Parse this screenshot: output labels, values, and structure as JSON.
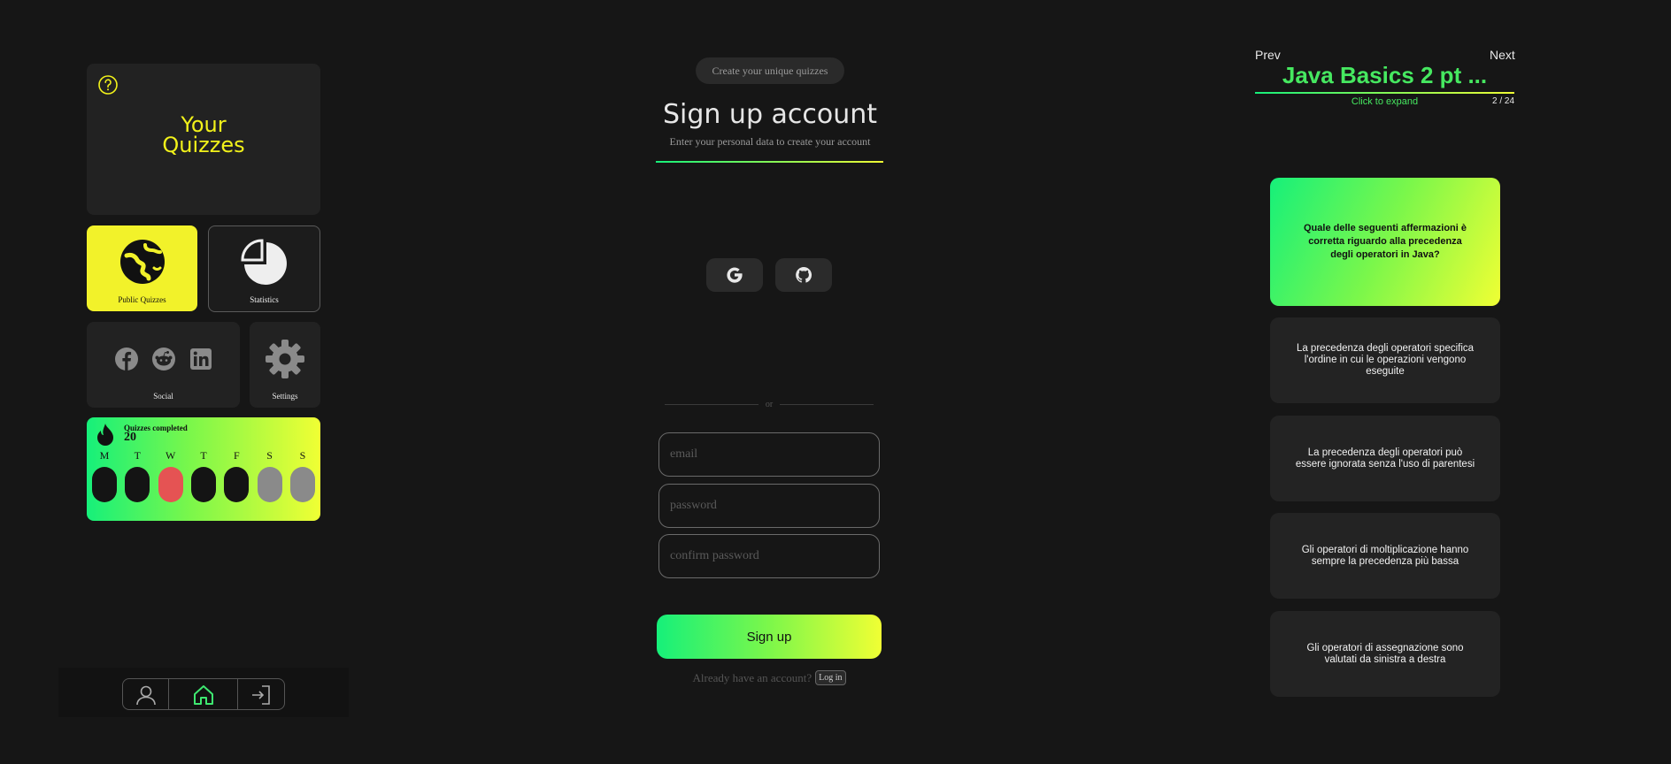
{
  "dashboard": {
    "your_quizzes": "Your\nQuizzes",
    "tiles": {
      "public_quizzes": "Public Quizzes",
      "statistics": "Statistics",
      "social": "Social",
      "settings": "Settings"
    },
    "streak": {
      "label": "Quizzes completed",
      "count": "20",
      "days": [
        {
          "letter": "M",
          "color": "#141414"
        },
        {
          "letter": "T",
          "color": "#141414"
        },
        {
          "letter": "W",
          "color": "#e55353"
        },
        {
          "letter": "T",
          "color": "#141414"
        },
        {
          "letter": "F",
          "color": "#141414"
        },
        {
          "letter": "S",
          "color": "#8a8a8a"
        },
        {
          "letter": "S",
          "color": "#8a8a8a"
        }
      ]
    },
    "social_icons": [
      "facebook-icon",
      "reddit-icon",
      "linkedin-icon"
    ],
    "nav_icons": [
      "user-icon",
      "home-icon",
      "login-icon"
    ]
  },
  "signup": {
    "badge": "Create your unique quizzes",
    "title": "Sign up account",
    "subtitle": "Enter your personal data to create your account",
    "divider": "or",
    "email_placeholder": "email",
    "password_placeholder": "password",
    "confirm_placeholder": "confirm password",
    "button": "Sign up",
    "have_account": "Already have an account?",
    "login": "Log in"
  },
  "quiz": {
    "prev": "Prev",
    "next": "Next",
    "title": "Java Basics 2 pt ...",
    "expand": "Click to expand",
    "counter": "2 / 24",
    "question": "Quale delle seguenti affermazioni è corretta riguardo alla precedenza degli operatori in Java?",
    "answers": [
      "La precedenza degli operatori specifica l'ordine in cui le operazioni vengono eseguite",
      "La precedenza degli operatori può essere ignorata senza l'uso di parentesi",
      "Gli operatori di moltiplicazione hanno sempre la precedenza più bassa",
      "Gli operatori di assegnazione sono valutati da sinistra a destra"
    ]
  },
  "colors": {
    "accent_green": "#16f07a",
    "accent_yellow": "#f0ff34",
    "title_yellow": "#f2f21a",
    "background": "#161616"
  }
}
